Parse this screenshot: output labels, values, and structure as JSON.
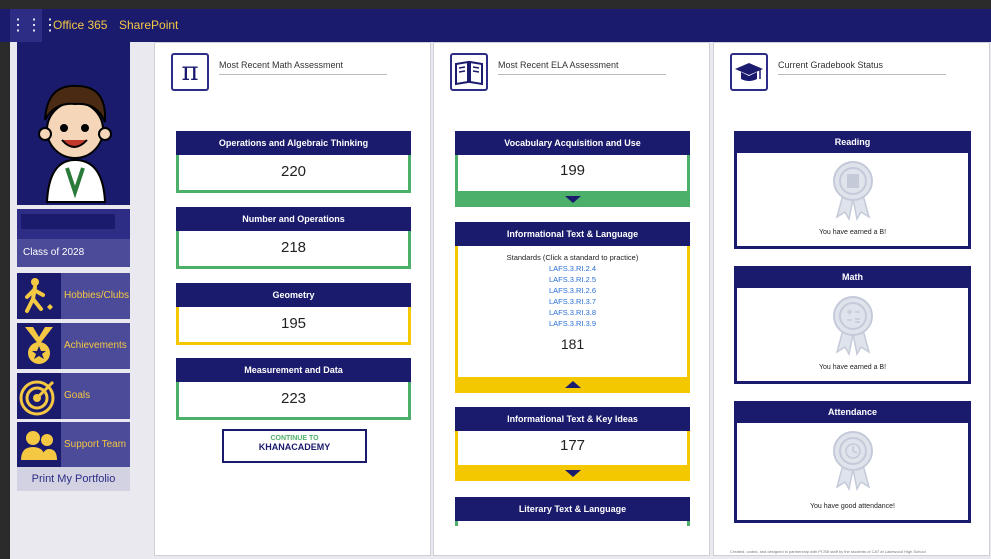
{
  "suitebar": {
    "apps_label": "⋮⋮⋮",
    "office_label": "Office 365",
    "sharepoint_label": "SharePoint"
  },
  "sidebar": {
    "class_label": "Class of 2028",
    "items": [
      {
        "label": "Hobbies/Clubs",
        "icon": "walking-person-icon"
      },
      {
        "label": "Achievements",
        "icon": "medal-icon"
      },
      {
        "label": "Goals",
        "icon": "target-icon"
      },
      {
        "label": "Support Team",
        "icon": "people-icon"
      }
    ],
    "print_label": "Print My Portfolio"
  },
  "math": {
    "title": "Most Recent Math Assessment",
    "icon": "pi-icon",
    "icon_glyph": "π",
    "cards": [
      {
        "label": "Operations and Algebraic Thinking",
        "score": "220",
        "status": "green"
      },
      {
        "label": "Number and Operations",
        "score": "218",
        "status": "green"
      },
      {
        "label": "Geometry",
        "score": "195",
        "status": "yellow"
      },
      {
        "label": "Measurement and Data",
        "score": "223",
        "status": "green"
      }
    ],
    "khan_line1": "CONTINUE TO",
    "khan_line2": "KHANACADEMY"
  },
  "ela": {
    "title": "Most Recent ELA Assessment",
    "icon": "book-icon",
    "cards": [
      {
        "label": "Vocabulary Acquisition and Use",
        "score": "199",
        "status": "green"
      },
      {
        "label": "Informational Text & Language",
        "score": "181",
        "status": "yellow"
      },
      {
        "label": "Informational Text & Key Ideas",
        "score": "177",
        "status": "yellow"
      },
      {
        "label": "Literary Text & Language",
        "status": "green"
      }
    ],
    "standards_heading": "Standards (Click a standard to practice)",
    "standards": [
      "LAFS.3.RI.2.4",
      "LAFS.3.RI.2.5",
      "LAFS.3.RI.2.6",
      "LAFS.3.RI.3.7",
      "LAFS.3.RI.3.8",
      "LAFS.3.RI.3.9"
    ]
  },
  "gradebook": {
    "title": "Current Gradebook Status",
    "icon": "graduation-cap-icon",
    "cards": [
      {
        "label": "Reading",
        "message": "You have earned a B!"
      },
      {
        "label": "Math",
        "message": "You have earned a B!"
      },
      {
        "label": "Attendance",
        "message": "You have good attendance!"
      }
    ]
  },
  "footer_note": "Created, coded, and designed in partnership with PCSB staff by the students of CAT at Lakewood High School",
  "colors": {
    "navy": "#1b1b6e",
    "accent": "#f4c842",
    "green": "#4caf6a",
    "yellow": "#f4c800"
  }
}
